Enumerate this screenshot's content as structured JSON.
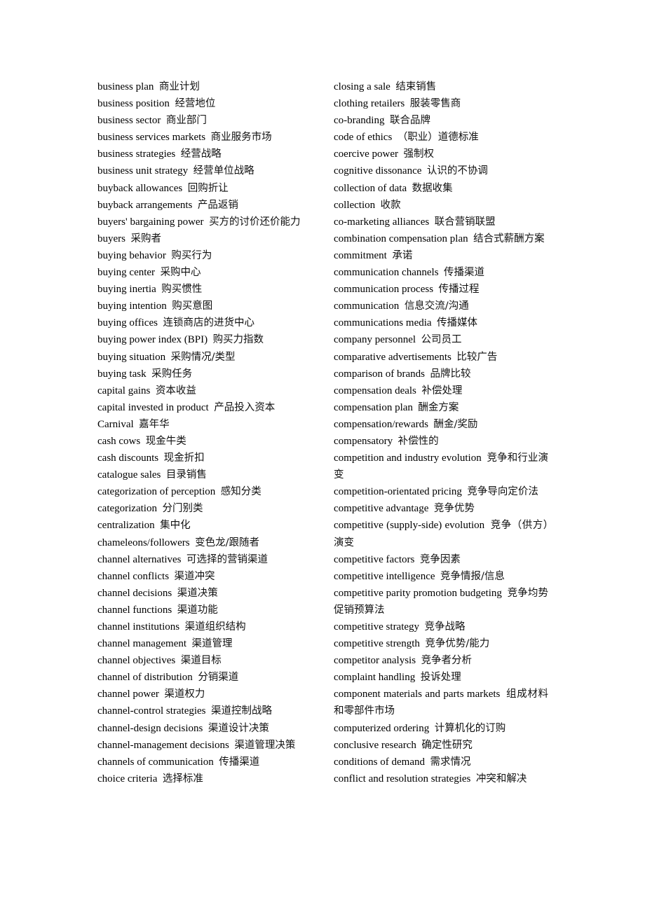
{
  "document": {
    "left_column": [
      {
        "en": "business plan",
        "zh": "商业计划"
      },
      {
        "en": "business position",
        "zh": "经营地位"
      },
      {
        "en": "business sector",
        "zh": "商业部门"
      },
      {
        "en": "business services markets",
        "zh": "商业服务市场"
      },
      {
        "en": "business strategies",
        "zh": "经营战略"
      },
      {
        "en": "business unit strategy",
        "zh": "经营单位战略"
      },
      {
        "en": "buyback allowances",
        "zh": "回购折让"
      },
      {
        "en": "buyback arrangements",
        "zh": "产品返销"
      },
      {
        "en": "buyers' bargaining power",
        "zh": "买方的讨价还价能力"
      },
      {
        "en": "buyers",
        "zh": "采购者"
      },
      {
        "en": "buying behavior",
        "zh": "购买行为"
      },
      {
        "en": "buying center",
        "zh": "采购中心"
      },
      {
        "en": "buying inertia",
        "zh": "购买惯性"
      },
      {
        "en": "buying intention",
        "zh": "购买意图"
      },
      {
        "en": "buying offices",
        "zh": "连锁商店的进货中心"
      },
      {
        "en": "buying power index (BPI)",
        "zh": "购买力指数"
      },
      {
        "en": "buying situation",
        "zh": "采购情况/类型"
      },
      {
        "en": "buying task",
        "zh": "采购任务"
      },
      {
        "en": "capital gains",
        "zh": "资本收益"
      },
      {
        "en": "capital invested in product",
        "zh": "产品投入资本"
      },
      {
        "en": "Carnival",
        "zh": "嘉年华"
      },
      {
        "en": "cash cows",
        "zh": "现金牛类"
      },
      {
        "en": "cash discounts",
        "zh": "现金折扣"
      },
      {
        "en": "catalogue sales",
        "zh": "目录销售"
      },
      {
        "en": "categorization of perception",
        "zh": "感知分类"
      },
      {
        "en": "categorization",
        "zh": "分门别类"
      },
      {
        "en": "centralization",
        "zh": "集中化"
      },
      {
        "en": "chameleons/followers",
        "zh": "变色龙/跟随者"
      },
      {
        "en": "channel alternatives",
        "zh": "可选择的营销渠道"
      },
      {
        "en": "channel conflicts",
        "zh": "渠道冲突"
      },
      {
        "en": "channel decisions",
        "zh": "渠道决策"
      },
      {
        "en": "channel functions",
        "zh": "渠道功能"
      },
      {
        "en": "channel institutions",
        "zh": "渠道组织结构"
      },
      {
        "en": "channel management",
        "zh": "渠道管理"
      },
      {
        "en": "channel objectives",
        "zh": "渠道目标"
      },
      {
        "en": "channel of distribution",
        "zh": "分销渠道"
      },
      {
        "en": "channel power",
        "zh": "渠道权力"
      },
      {
        "en": "channel-control strategies",
        "zh": "渠道控制战略"
      },
      {
        "en": "channel-design decisions",
        "zh": "渠道设计决策"
      },
      {
        "en": "channel-management decisions",
        "zh": "渠道管理决策"
      },
      {
        "en": "channels of communication",
        "zh": "传播渠道"
      },
      {
        "en": "choice criteria",
        "zh": "选择标准"
      }
    ],
    "right_column": [
      {
        "en": "closing a sale",
        "zh": "结束销售"
      },
      {
        "en": "clothing retailers",
        "zh": "服装零售商"
      },
      {
        "en": "co-branding",
        "zh": "联合品牌"
      },
      {
        "en": "code of ethics",
        "zh": "（职业）道德标准"
      },
      {
        "en": "coercive power",
        "zh": "强制权"
      },
      {
        "en": "cognitive dissonance",
        "zh": "认识的不协调"
      },
      {
        "en": "collection of data",
        "zh": "数据收集"
      },
      {
        "en": "collection",
        "zh": "收款"
      },
      {
        "en": "co-marketing alliances",
        "zh": "联合营销联盟"
      },
      {
        "en": "combination compensation plan",
        "zh": "结合式薪酬方案"
      },
      {
        "en": "commitment",
        "zh": "承诺"
      },
      {
        "en": "communication channels",
        "zh": "传播渠道"
      },
      {
        "en": "communication process",
        "zh": "传播过程"
      },
      {
        "en": "communication",
        "zh": "信息交流/沟通"
      },
      {
        "en": "communications media",
        "zh": "传播媒体"
      },
      {
        "en": "company personnel",
        "zh": "公司员工"
      },
      {
        "en": "comparative advertisements",
        "zh": "比较广告"
      },
      {
        "en": "comparison of brands",
        "zh": "品牌比较"
      },
      {
        "en": "compensation deals",
        "zh": "补偿处理"
      },
      {
        "en": "compensation plan",
        "zh": "酬金方案"
      },
      {
        "en": "compensation/rewards",
        "zh": "酬金/奖励"
      },
      {
        "en": "compensatory",
        "zh": "补偿性的"
      },
      {
        "en": "competition and industry evolution",
        "zh": "竞争和行业演变"
      },
      {
        "en": "competition-orientated pricing",
        "zh": "竞争导向定价法"
      },
      {
        "en": "competitive   advantage",
        "zh": "竞争优势"
      },
      {
        "en": "competitive (supply-side) evolution",
        "zh": "竞争（供方）演变"
      },
      {
        "en": "competitive factors",
        "zh": "竞争因素"
      },
      {
        "en": "competitive intelligence",
        "zh": "竞争情报/信息"
      },
      {
        "en": "competitive parity promotion budgeting",
        "zh": "竞争均势促销预算法"
      },
      {
        "en": "competitive strategy",
        "zh": "竞争战略"
      },
      {
        "en": "competitive strength",
        "zh": "竞争优势/能力"
      },
      {
        "en": "competitor analysis",
        "zh": "竞争者分析"
      },
      {
        "en": "complaint handling",
        "zh": "投诉处理"
      },
      {
        "en": "component materials and parts markets",
        "zh": "组成材料和零部件市场"
      },
      {
        "en": "computerized ordering",
        "zh": "计算机化的订购"
      },
      {
        "en": "conclusive research",
        "zh": "确定性研究"
      },
      {
        "en": "conditions of demand",
        "zh": "需求情况"
      },
      {
        "en": "conflict and resolution strategies",
        "zh": "冲突和解决"
      }
    ]
  }
}
